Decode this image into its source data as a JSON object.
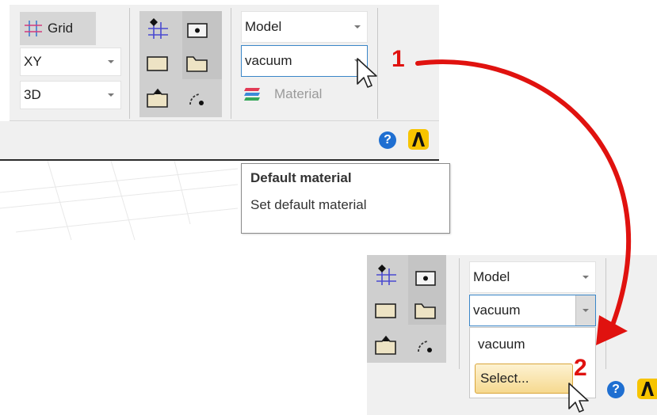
{
  "toolbar_top": {
    "grid_button_label": "Grid",
    "plane_select_value": "XY",
    "view_select_value": "3D",
    "model_select_value": "Model",
    "material_select_value": "vacuum",
    "material_button_label": "Material"
  },
  "tooltip": {
    "title": "Default material",
    "description": "Set default material"
  },
  "toolbar_zoom": {
    "model_select_value": "Model",
    "material_select_value": "vacuum",
    "dropdown_options": [
      "vacuum",
      "Select..."
    ]
  },
  "callouts": {
    "step1": "1",
    "step2": "2"
  },
  "colors": {
    "arrow": "#e0120f",
    "help": "#1f6fd1",
    "logo": "#f7c400"
  }
}
